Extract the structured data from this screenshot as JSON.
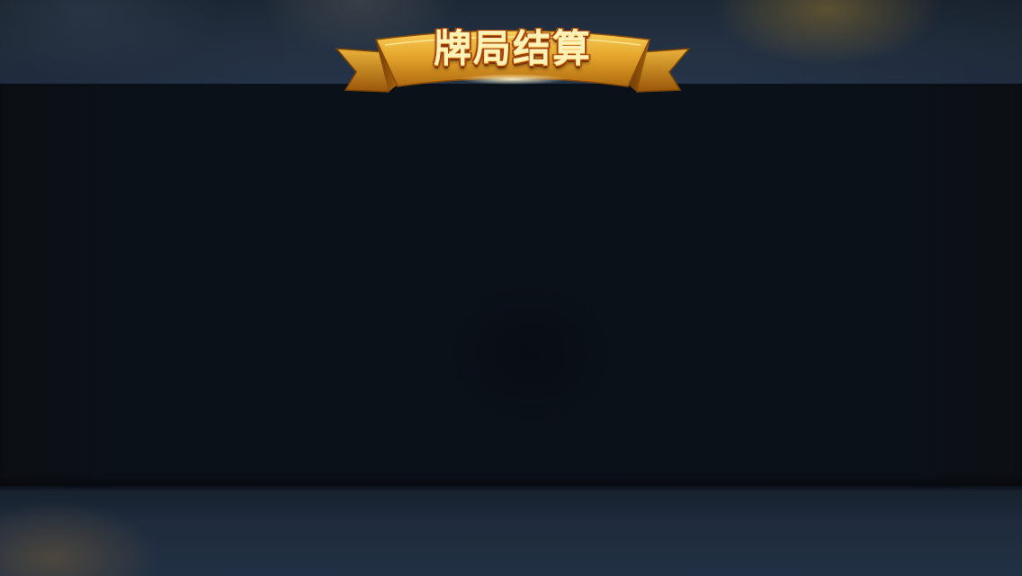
{
  "banner": {
    "title": "牌局结算"
  },
  "colors": {
    "ribbon_gold": "#e2a42a",
    "ribbon_dark": "#a8630d",
    "title_fill": "#fff2b8",
    "title_outline": "#a8460c",
    "panel_bg": "#0b1119",
    "band_bg": "#243142"
  }
}
